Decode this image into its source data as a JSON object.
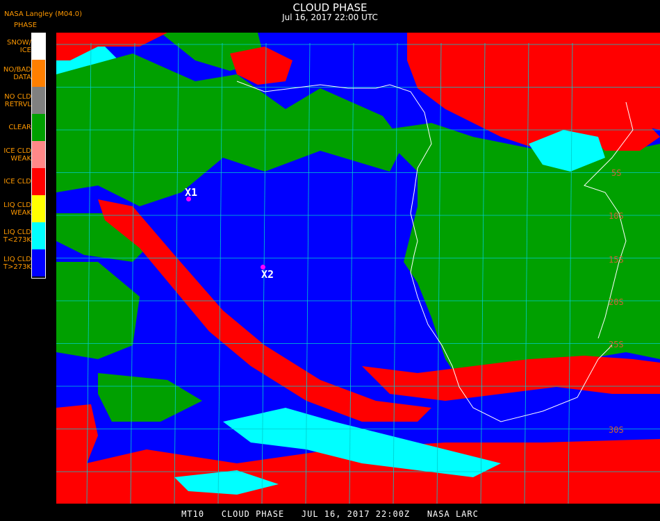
{
  "header": {
    "title": "CLOUD PHASE",
    "subtitle": "Jul 16, 2017 22:00 UTC",
    "producer": "NASA Langley (M04.0)",
    "legend_title": "PHASE"
  },
  "legend": [
    {
      "label": "SNOW/\nICE",
      "color": "#ffffff"
    },
    {
      "label": "NO/BAD\nDATA",
      "color": "#ff7f00"
    },
    {
      "label": "NO CLD\nRETRVL",
      "color": "#808080"
    },
    {
      "label": "CLEAR",
      "color": "#00a000"
    },
    {
      "label": "ICE CLD\nWEAK",
      "color": "#ff8888"
    },
    {
      "label": "ICE CLD",
      "color": "#ff0000"
    },
    {
      "label": "LIQ CLD\nWEAK",
      "color": "#ffff00"
    },
    {
      "label": "LIQ CLD\nT<273K",
      "color": "#00ffff"
    },
    {
      "label": "LIQ CLD\nT>273K",
      "color": "#0000ff"
    }
  ],
  "markers": [
    {
      "label": "X1"
    },
    {
      "label": "X2"
    }
  ],
  "lat_labels": [
    "5S",
    "10S",
    "15S",
    "20S",
    "25S",
    "30S"
  ],
  "footer": "MT10   CLOUD PHASE   JUL 16, 2017 22:00Z   NASA LARC"
}
